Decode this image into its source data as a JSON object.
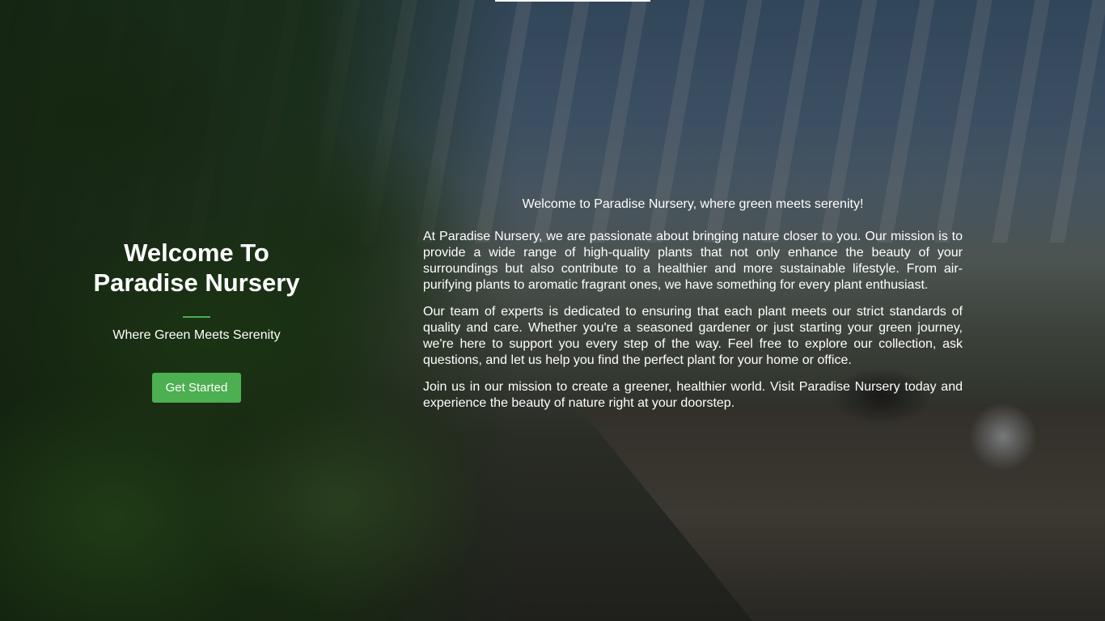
{
  "hero": {
    "title_line1": "Welcome To",
    "title_line2": "Paradise Nursery",
    "subtitle": "Where Green Meets Serenity",
    "cta_label": "Get Started"
  },
  "about": {
    "intro": "Welcome to Paradise Nursery, where green meets serenity!",
    "paragraphs": [
      "At Paradise Nursery, we are passionate about bringing nature closer to you. Our mission is to provide a wide range of high-quality plants that not only enhance the beauty of your surroundings but also contribute to a healthier and more sustainable lifestyle. From air-purifying plants to aromatic fragrant ones, we have something for every plant enthusiast.",
      "Our team of experts is dedicated to ensuring that each plant meets our strict standards of quality and care. Whether you're a seasoned gardener or just starting your green journey, we're here to support you every step of the way. Feel free to explore our collection, ask questions, and let us help you find the perfect plant for your home or office.",
      "Join us in our mission to create a greener, healthier world. Visit Paradise Nursery today and experience the beauty of nature right at your doorstep."
    ]
  },
  "colors": {
    "accent": "#4caf50",
    "text": "#ffffff"
  }
}
